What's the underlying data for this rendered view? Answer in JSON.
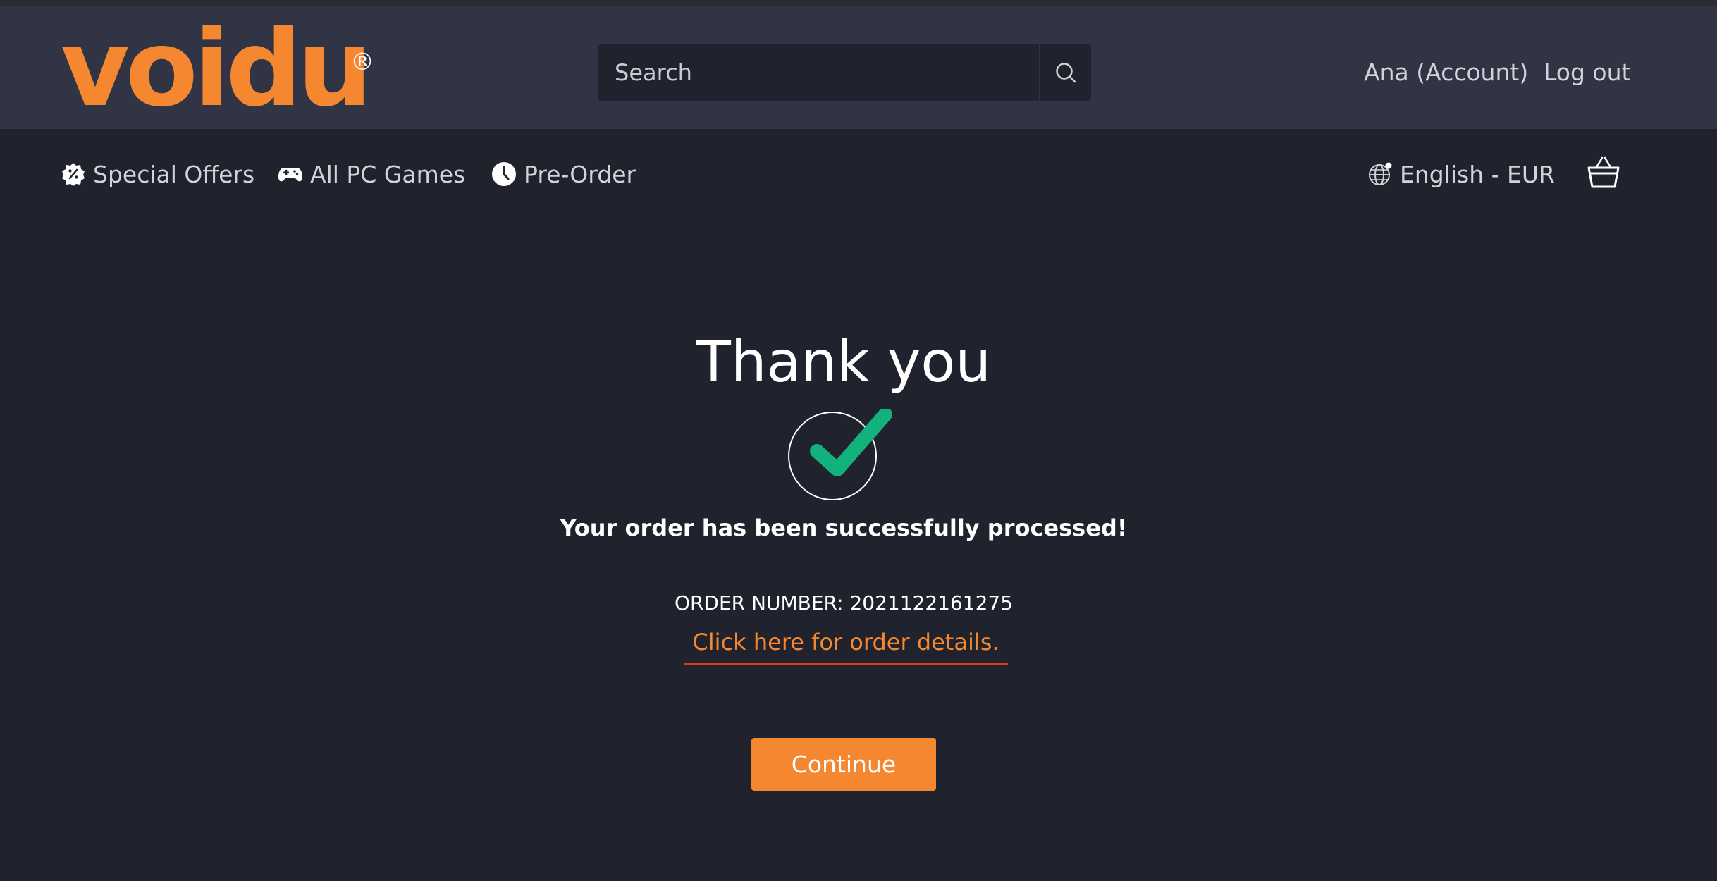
{
  "brand": {
    "logo_text": "voidu",
    "registered_mark": "®",
    "accent_color": "#f68731"
  },
  "search": {
    "placeholder": "Search",
    "value": ""
  },
  "account": {
    "user_link": "Ana (Account)",
    "logout_link": "Log out"
  },
  "nav": {
    "special_offers": "Special Offers",
    "all_pc_games": "All PC Games",
    "pre_order": "Pre-Order",
    "language_currency": "English - EUR"
  },
  "icons": {
    "special_offers": "discount-badge-icon",
    "all_pc_games": "gamepad-icon",
    "pre_order": "clock-icon",
    "language": "globe-icon",
    "cart": "basket-icon",
    "search": "search-icon",
    "success": "checkmark-icon"
  },
  "confirmation": {
    "title": "Thank you",
    "message": "Your order has been successfully processed!",
    "order_number": "ORDER NUMBER: 2021122161275",
    "details_link": "Click here for order details.",
    "continue_label": "Continue",
    "success_color": "#12b17e",
    "link_underline_color": "#e0341c"
  }
}
